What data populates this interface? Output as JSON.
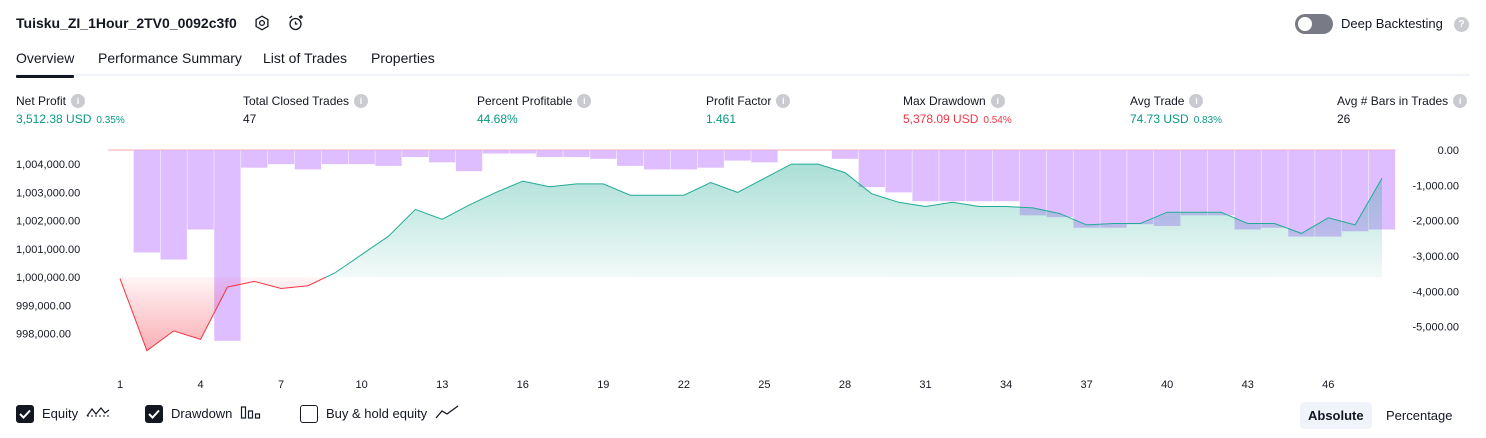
{
  "header": {
    "strategy_name": "Tuisku_ZI_1Hour_2TV0_0092c3f0",
    "deep_backtesting_label": "Deep Backtesting",
    "deep_backtesting_on": false
  },
  "tabs": [
    {
      "label": "Overview",
      "active": true
    },
    {
      "label": "Performance Summary",
      "active": false
    },
    {
      "label": "List of Trades",
      "active": false
    },
    {
      "label": "Properties",
      "active": false
    }
  ],
  "stats": [
    {
      "label": "Net Profit",
      "value": "3,512.38 USD",
      "pct": "0.35%",
      "tone": "pos"
    },
    {
      "label": "Total Closed Trades",
      "value": "47",
      "pct": "",
      "tone": "neutral"
    },
    {
      "label": "Percent Profitable",
      "value": "44.68%",
      "pct": "",
      "tone": "pos"
    },
    {
      "label": "Profit Factor",
      "value": "1.461",
      "pct": "",
      "tone": "pos"
    },
    {
      "label": "Max Drawdown",
      "value": "5,378.09 USD",
      "pct": "0.54%",
      "tone": "neg"
    },
    {
      "label": "Avg Trade",
      "value": "74.73 USD",
      "pct": "0.83%",
      "tone": "pos"
    },
    {
      "label": "Avg # Bars in Trades",
      "value": "26",
      "pct": "",
      "tone": "neutral"
    }
  ],
  "chart_data": {
    "type": "area",
    "x_ticks": [
      "1",
      "4",
      "7",
      "10",
      "13",
      "16",
      "19",
      "22",
      "25",
      "28",
      "31",
      "34",
      "37",
      "40",
      "43",
      "46"
    ],
    "left_axis": {
      "ticks": [
        "1,004,000.00",
        "1,003,000.00",
        "1,002,000.00",
        "1,001,000.00",
        "1,000,000.00",
        "999,000.00",
        "998,000.00"
      ],
      "ylim": [
        997000,
        1004500
      ]
    },
    "right_axis": {
      "ticks": [
        "0.00",
        "-1,000.00",
        "-2,000.00",
        "-3,000.00",
        "-4,000.00",
        "-5,000.00"
      ],
      "ylim": [
        -6000,
        0
      ]
    },
    "baseline": 1000000,
    "series": [
      {
        "name": "Equity",
        "axis": "left",
        "x": [
          1,
          2,
          3,
          4,
          5,
          6,
          7,
          8,
          9,
          10,
          11,
          12,
          13,
          14,
          15,
          16,
          17,
          18,
          19,
          20,
          21,
          22,
          23,
          24,
          25,
          26,
          27,
          28,
          29,
          30,
          31,
          32,
          33,
          34,
          35,
          36,
          37,
          38,
          39,
          40,
          41,
          42,
          43,
          44,
          45,
          46,
          47,
          48
        ],
        "values": [
          999950,
          997400,
          998100,
          997800,
          999650,
          999850,
          999600,
          999700,
          1000150,
          1000800,
          1001450,
          1002400,
          1002050,
          1002550,
          1003000,
          1003400,
          1003200,
          1003300,
          1003300,
          1002900,
          1002900,
          1002900,
          1003350,
          1003000,
          1003500,
          1004000,
          1004000,
          1003700,
          1002950,
          1002650,
          1002500,
          1002650,
          1002500,
          1002500,
          1002450,
          1002250,
          1001850,
          1001900,
          1001900,
          1002300,
          1002300,
          1002300,
          1001900,
          1001900,
          1001550,
          1002100,
          1001850,
          1003500
        ]
      },
      {
        "name": "Drawdown",
        "axis": "right",
        "x": [
          1,
          2,
          3,
          4,
          5,
          6,
          7,
          8,
          9,
          10,
          11,
          12,
          13,
          14,
          15,
          16,
          17,
          18,
          19,
          20,
          21,
          22,
          23,
          24,
          25,
          26,
          27,
          28,
          29,
          30,
          31,
          32,
          33,
          34,
          35,
          36,
          37,
          38,
          39,
          40,
          41,
          42,
          43,
          44,
          45,
          46,
          47,
          48
        ],
        "values": [
          0,
          -2900,
          -3100,
          -2250,
          -5400,
          -500,
          -400,
          -550,
          -400,
          -400,
          -450,
          -200,
          -350,
          -600,
          -100,
          -100,
          -200,
          -200,
          -250,
          -450,
          -550,
          -550,
          -500,
          -300,
          -350,
          0,
          0,
          -250,
          -1050,
          -1200,
          -1450,
          -1450,
          -1450,
          -1450,
          -1850,
          -1900,
          -2200,
          -2200,
          -2100,
          -2150,
          -1850,
          -1850,
          -2250,
          -2200,
          -2450,
          -2450,
          -2300,
          -2250
        ]
      }
    ],
    "colors": {
      "equity_line": "#22ab94",
      "equity_fill": "#22ab94",
      "equity_loss_line": "#f23645",
      "equity_loss_fill": "#f23645",
      "drawdown_fill": "#d9b3ff"
    }
  },
  "legend": {
    "equity_label": "Equity",
    "drawdown_label": "Drawdown",
    "buyhold_label": "Buy & hold equity",
    "equity_checked": true,
    "drawdown_checked": true,
    "buyhold_checked": false
  },
  "view_toggle": {
    "absolute_label": "Absolute",
    "percentage_label": "Percentage",
    "active": "Absolute"
  }
}
